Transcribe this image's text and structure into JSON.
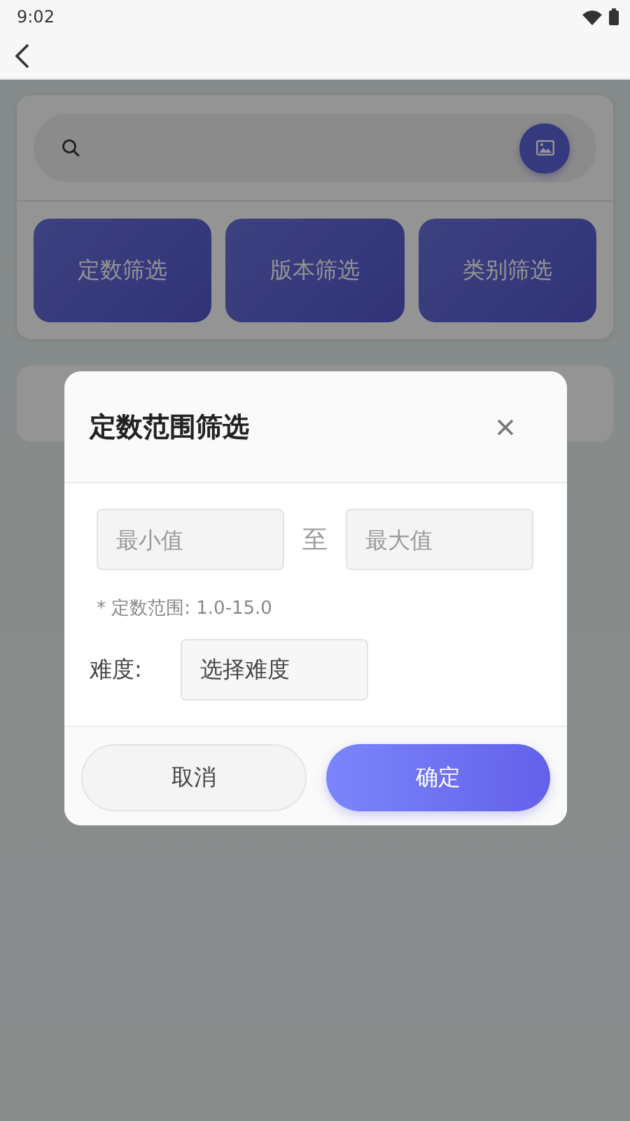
{
  "status_bar": {
    "time": "9:02"
  },
  "filter_buttons": [
    "定数筛选",
    "版本筛选",
    "类别筛选"
  ],
  "dialog": {
    "title": "定数范围筛选",
    "min_field": {
      "placeholder": "最小值"
    },
    "separator": "至",
    "max_field": {
      "placeholder": "最大值"
    },
    "hint": "* 定数范围: 1.0-15.0",
    "difficulty_label": "难度:",
    "difficulty_select": {
      "placeholder": "选择难度"
    },
    "buttons": [
      {
        "label": "取消",
        "kind": "secondary"
      },
      {
        "label": "确定",
        "kind": "primary"
      }
    ]
  }
}
